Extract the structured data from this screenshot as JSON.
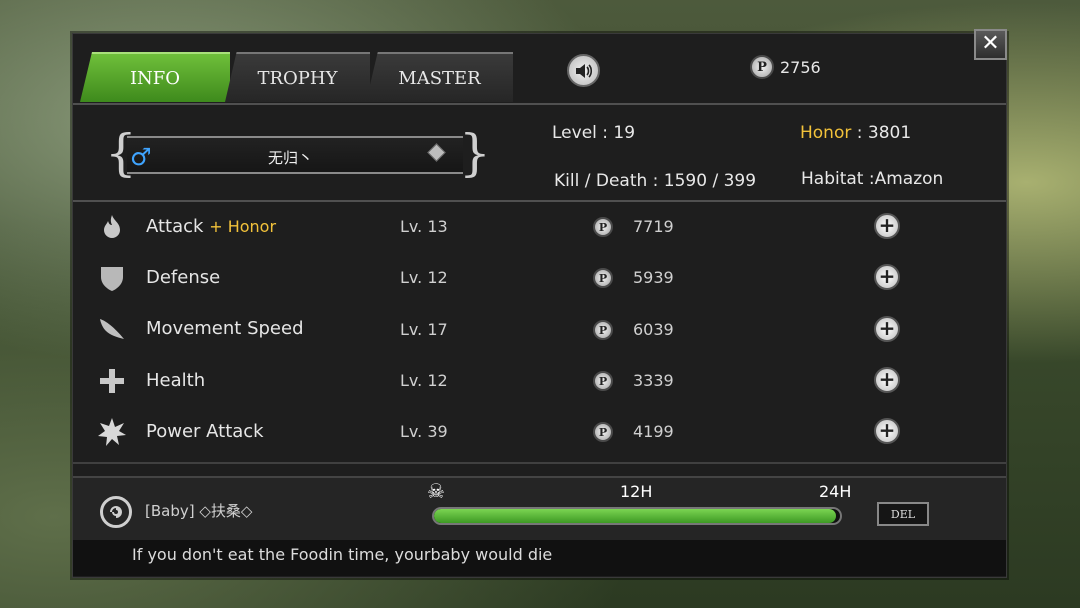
{
  "tabs": [
    {
      "label": "INFO",
      "active": true
    },
    {
      "label": "TROPHY",
      "active": false
    },
    {
      "label": "MASTER",
      "active": false
    }
  ],
  "header": {
    "points": "2756",
    "sound_icon": "speaker-icon",
    "close_label": "✕"
  },
  "player": {
    "gender_symbol": "♂",
    "name": "无归丶",
    "level_label": "Level",
    "level_value": ": 19",
    "honor_label": "Honor",
    "honor_value": ": 3801",
    "kd_label": "Kill / Death",
    "kd_value": ": 1590 / 399",
    "habitat_label": "Habitat",
    "habitat_value": ":Amazon"
  },
  "coin_symbol": "P",
  "skills": [
    {
      "name": "Attack",
      "extra": "+ Honor",
      "level": "Lv. 13",
      "cost": "7719",
      "icon": "flame-icon"
    },
    {
      "name": "Defense",
      "extra": "",
      "level": "Lv. 12",
      "cost": "5939",
      "icon": "shield-icon"
    },
    {
      "name": "Movement Speed",
      "extra": "",
      "level": "Lv. 17",
      "cost": "6039",
      "icon": "wing-icon"
    },
    {
      "name": "Health",
      "extra": "",
      "level": "Lv. 12",
      "cost": "3339",
      "icon": "cross-icon"
    },
    {
      "name": "Power Attack",
      "extra": "",
      "level": "Lv. 39",
      "cost": "4199",
      "icon": "burst-icon"
    }
  ],
  "baby": {
    "tag": "[Baby] ◇扶桑◇",
    "time_12": "12H",
    "time_24": "24H",
    "progress_fraction": 0.99,
    "del_label": "DEL",
    "tip": "If you don't eat the Foodin time, yourbaby would die"
  },
  "colors": {
    "active_tab": "#4f9e2a",
    "gold": "#f2c23a",
    "male_blue": "#3fa4ff",
    "progress_green": "#5cb83a"
  }
}
